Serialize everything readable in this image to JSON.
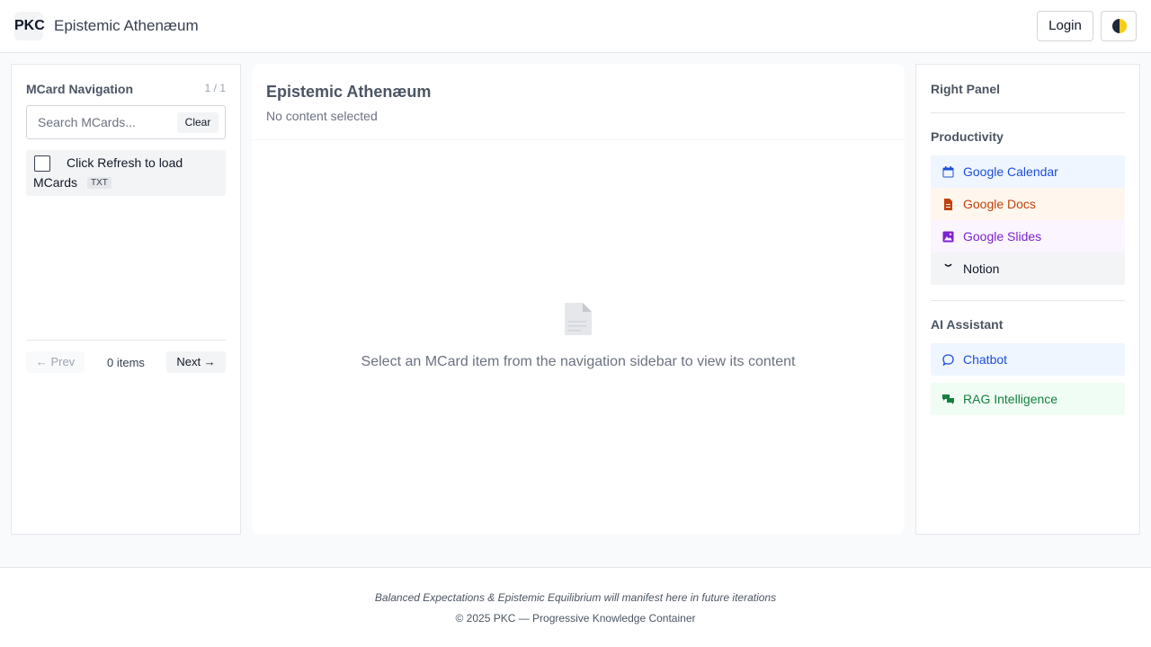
{
  "header": {
    "logo": "PKC",
    "title": "Epistemic Athenæum",
    "login_label": "Login",
    "theme_icon": "theme-toggle-icon"
  },
  "sidebar": {
    "title": "MCard Navigation",
    "page_indicator": "1 / 1",
    "search_placeholder": "Search MCards...",
    "clear_label": "Clear",
    "items": [
      {
        "line1": "Click Refresh to load",
        "line2": "MCards",
        "badge": "TXT"
      }
    ],
    "prev_label": "← Prev",
    "item_count": "0 items",
    "next_label": "Next →"
  },
  "main": {
    "title": "Epistemic Athenæum",
    "subtitle": "No content selected",
    "empty_icon": "document-icon",
    "empty_message": "Select an MCard item from the navigation sidebar to view its content"
  },
  "right_panel": {
    "title": "Right Panel",
    "productivity": {
      "heading": "Productivity",
      "items": [
        {
          "label": "Google Calendar",
          "icon": "calendar-icon",
          "color": "#1d4ed8",
          "bg": "#eff6ff"
        },
        {
          "label": "Google Docs",
          "icon": "document-icon",
          "color": "#c2410c",
          "bg": "#fff7ed"
        },
        {
          "label": "Google Slides",
          "icon": "image-icon",
          "color": "#7e22ce",
          "bg": "#faf5ff"
        },
        {
          "label": "Notion",
          "icon": "notion-icon",
          "color": "#111827",
          "bg": "#f3f4f6"
        }
      ]
    },
    "ai": {
      "heading": "AI Assistant",
      "items": [
        {
          "label": "Chatbot",
          "icon": "chat-bubble-icon",
          "color": "#1d4ed8",
          "bg": "#eff6ff"
        },
        {
          "label": "RAG Intelligence",
          "icon": "chat-bubbles-icon",
          "color": "#15803d",
          "bg": "#f0fdf4"
        }
      ]
    }
  },
  "footer": {
    "note": "Balanced Expectations & Epistemic Equilibrium will manifest here in future iterations",
    "copyright": "© 2025 PKC — Progressive Knowledge Container"
  }
}
